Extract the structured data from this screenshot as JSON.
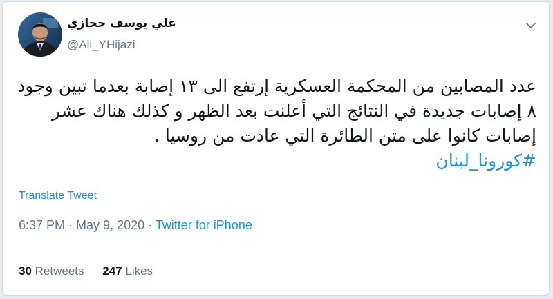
{
  "tweet": {
    "author": {
      "display_name": "علي يوسف حجازي",
      "handle": "@Ali_YHijazi",
      "avatar_icon": "profile-photo"
    },
    "menu_icon": "chevron-down-icon",
    "text_lines": [
      "عدد المصابين من المحكمة العسكرية إرتفع الى ١٣ إصابة بعدما تبين وجود",
      "٨ إصابات جديدة في النتائج التي أعلنت بعد الظهر و كذلك هناك عشر",
      "إصابات كانوا على متن الطائرة التي عادت من روسيا ."
    ],
    "hashtag": "#كورونا_لبنان",
    "translate_label": "Translate Tweet",
    "time": "6:37 PM",
    "separator": " · ",
    "date": "May 9, 2020",
    "source": "Twitter for iPhone",
    "retweets_count": "30",
    "retweets_label": "Retweets",
    "likes_count": "247",
    "likes_label": "Likes"
  },
  "colors": {
    "link": "#1b95e0",
    "secondary": "#657786",
    "text": "#14171a",
    "background": "#e6ecf0"
  }
}
